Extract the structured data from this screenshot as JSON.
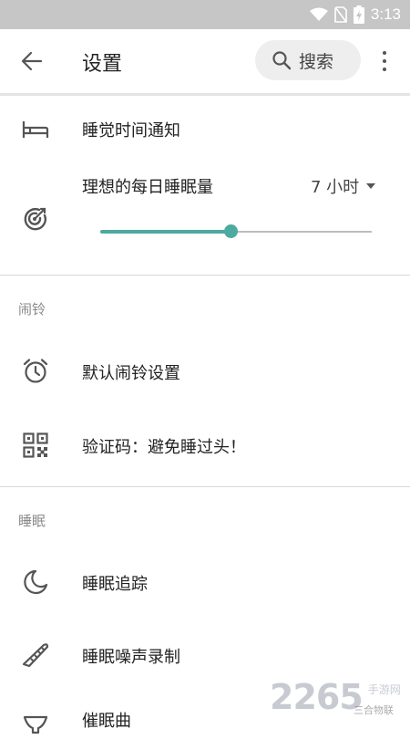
{
  "status_bar": {
    "time": "3:13"
  },
  "toolbar": {
    "title": "设置",
    "search_label": "搜索",
    "icons": {
      "back": "arrow-left-icon",
      "search": "search-icon",
      "menu": "more-vert-icon"
    }
  },
  "settings": {
    "bedtime_notification": {
      "label": "睡觉时间通知",
      "icon": "bed-icon"
    },
    "ideal_sleep": {
      "label": "理想的每日睡眠量",
      "value": "7 小时",
      "slider_fraction": 0.48,
      "accent_color": "#4caaa0",
      "icon": "target-icon"
    }
  },
  "sections": {
    "alarm": {
      "header": "闹铃",
      "items": [
        {
          "label": "默认闹铃设置",
          "icon": "alarm-clock-icon"
        },
        {
          "label": "验证码：避免睡过头！",
          "icon": "qr-code-icon"
        }
      ]
    },
    "sleep": {
      "header": "睡眠",
      "items": [
        {
          "label": "睡眠追踪",
          "icon": "moon-icon"
        },
        {
          "label": "睡眠噪声录制",
          "icon": "saw-icon"
        },
        {
          "label": "催眠曲",
          "icon": "bowl-icon"
        }
      ]
    }
  },
  "watermark": {
    "brand": "2265",
    "site": "手游网",
    "account": "三合物联"
  }
}
